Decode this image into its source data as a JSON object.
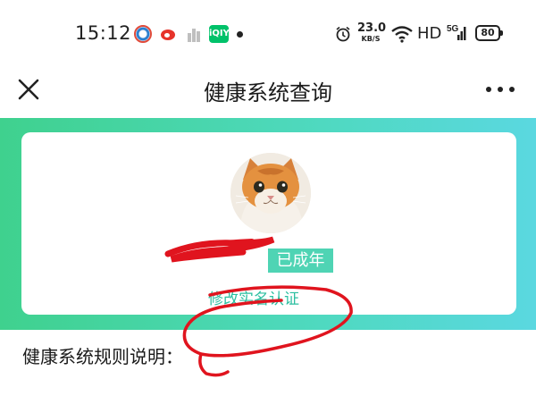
{
  "status_bar": {
    "time": "15:12",
    "app_icons": [
      "qq-browser-icon",
      "weibo-icon",
      "city-app-icon",
      "iqiyi-icon"
    ],
    "iqiyi_label": "iQIYI",
    "net_speed_value": "23.0",
    "net_speed_unit": "KB/S",
    "network_label": "HD",
    "signal_label": "5G",
    "battery_level": "80"
  },
  "header": {
    "title": "健康系统查询",
    "close_icon": "close-icon",
    "more_icon": "more-icon"
  },
  "profile": {
    "badge": "已成年",
    "modify_link": "修改实名认证"
  },
  "rules": {
    "title": "健康系统规则说明："
  },
  "colors": {
    "banner_start": "#3fd18e",
    "banner_end": "#5ad8e0",
    "badge": "#4fd4b4",
    "link": "#2bbfa0",
    "annotation": "#e0141e"
  }
}
